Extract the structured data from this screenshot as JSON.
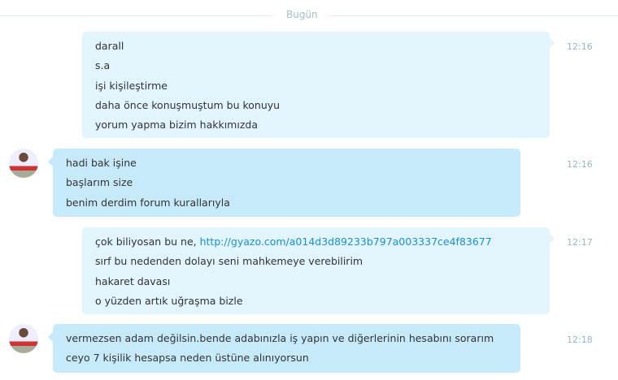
{
  "date_divider": "Bugün",
  "messages": [
    {
      "dir": "out",
      "time": "12:16",
      "lines": [
        "darall",
        "s.a",
        "işi kişileştirme",
        "daha önce konuşmuştum bu konuyu",
        "yorum yapma bizim hakkımızda"
      ]
    },
    {
      "dir": "in",
      "time": "12:16",
      "lines": [
        "hadi bak işine",
        "başlarım size",
        "benim derdim forum kurallarıyla"
      ]
    },
    {
      "dir": "out",
      "time": "12:17",
      "first_prefix": "çok biliyosan bu ne, ",
      "link": "http://gyazo.com/a014d3d89233b797a003337ce4f83677",
      "lines": [
        "sırf bu nedenden dolayı seni mahkemeye verebilirim",
        "hakaret davası",
        "o yüzden artık uğraşma bizle"
      ]
    },
    {
      "dir": "in",
      "time": "12:18",
      "lines": [
        "vermezsen adam değilsin.bende adabınızla iş yapın ve diğerlerinin hesabını sorarım",
        "ceyo 7 kişilik hesapsa neden üstüne alınıyorsun"
      ]
    }
  ]
}
